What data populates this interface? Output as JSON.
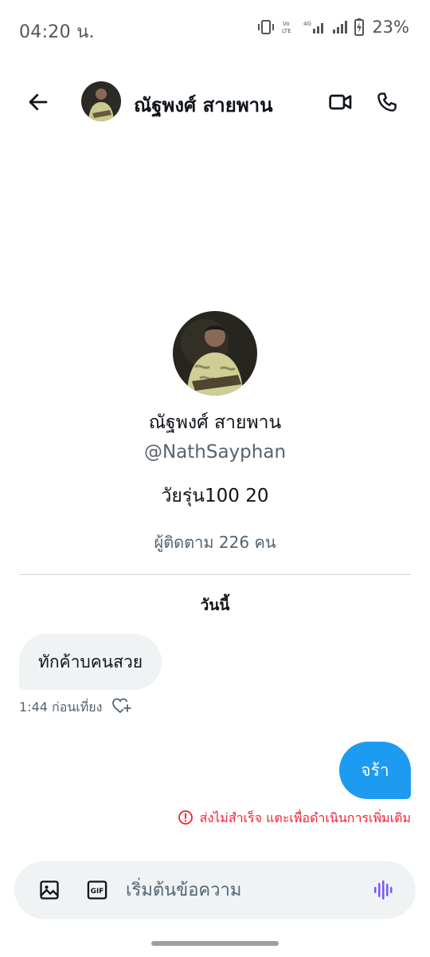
{
  "status_bar": {
    "time": "04:20 น.",
    "battery": "23%",
    "icons": [
      "vibrate-icon",
      "volte-icon",
      "4g-signal-icon",
      "signal-icon",
      "battery-charging-icon"
    ]
  },
  "header": {
    "name": "ณัฐพงศ์ สายพาน",
    "icons": [
      "back-arrow-icon",
      "video-call-icon",
      "phone-call-icon"
    ]
  },
  "profile": {
    "name": "ณัฐพงศ์ สายพาน",
    "handle": "@NathSayphan",
    "bio": "วัยรุ่น100 20",
    "followers": "ผู้ติดตาม 226 คน"
  },
  "conversation": {
    "day_label": "วันนี้",
    "messages": [
      {
        "direction": "received",
        "text": "ทักค้าบคนสวย",
        "time": "1:44 ก่อนเที่ยง"
      },
      {
        "direction": "sent",
        "text": "จร้า",
        "error": "ส่งไม่สำเร็จ แตะเพื่อดำเนินการเพิ่มเติม"
      }
    ]
  },
  "composer": {
    "placeholder": "เริ่มต้นข้อความ",
    "gif_label": "GIF"
  },
  "colors": {
    "accent": "#1d9bf0",
    "error": "#f4212e",
    "bubble_received": "#eff3f4",
    "secondary_text": "#536471",
    "voice_icon": "#7856ff"
  }
}
